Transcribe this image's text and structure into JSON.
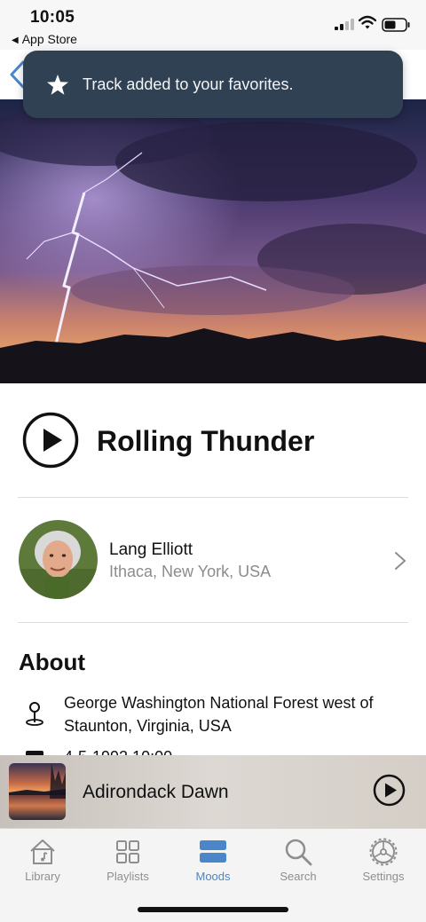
{
  "status": {
    "time": "10:05",
    "back_app": "App Store"
  },
  "toast": {
    "icon": "star-icon",
    "text": "Track added to your favorites."
  },
  "track": {
    "title": "Rolling Thunder"
  },
  "artist": {
    "name": "Lang Elliott",
    "location": "Ithaca, New York, USA"
  },
  "about": {
    "title": "About",
    "location": "George Washington National Forest west of Staunton, Virginia, USA",
    "date": "4-5-1992 10:00"
  },
  "mini_player": {
    "title": "Adirondack Dawn"
  },
  "tabs": [
    {
      "label": "Library",
      "icon": "library-icon",
      "active": false
    },
    {
      "label": "Playlists",
      "icon": "playlists-icon",
      "active": false
    },
    {
      "label": "Moods",
      "icon": "moods-icon",
      "active": true
    },
    {
      "label": "Search",
      "icon": "search-icon",
      "active": false
    },
    {
      "label": "Settings",
      "icon": "settings-icon",
      "active": false
    }
  ],
  "colors": {
    "accent": "#4a86c9",
    "toast_bg": "#2f4152",
    "secondary_text": "#8c8c8c"
  }
}
